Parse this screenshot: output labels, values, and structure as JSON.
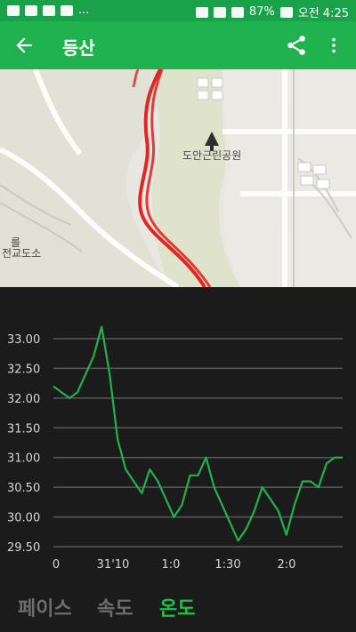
{
  "status": {
    "battery": "87%",
    "time": "오전 4:25",
    "dots": "..."
  },
  "appbar": {
    "title": "등산"
  },
  "map": {
    "label_park": "도안근린공원",
    "label_left": "전교도소",
    "label_left_top": "를"
  },
  "chart_data": {
    "type": "line",
    "title": "",
    "xlabel": "",
    "ylabel": "",
    "x_ticks": [
      "0",
      "31'10",
      "1:0",
      "1:30",
      "2:0"
    ],
    "y_ticks": [
      "33.00",
      "32.50",
      "32.00",
      "31.50",
      "31.00",
      "30.50",
      "30.00",
      "29.50"
    ],
    "ylim": [
      29.5,
      33.0
    ],
    "series": [
      {
        "color": "#20b24f",
        "x": [
          0,
          5,
          10,
          15,
          20,
          25,
          30,
          35,
          40,
          45,
          50,
          55,
          60,
          65,
          70,
          75,
          80,
          85,
          90,
          95,
          100,
          105,
          110,
          115,
          120,
          125,
          130,
          135,
          140,
          145,
          150,
          155,
          160,
          165,
          170,
          175,
          180
        ],
        "values": [
          32.2,
          32.1,
          32.0,
          32.1,
          32.4,
          32.7,
          33.2,
          32.4,
          31.3,
          30.8,
          30.6,
          30.4,
          30.8,
          30.6,
          30.3,
          30.0,
          30.2,
          30.7,
          30.7,
          31.0,
          30.5,
          30.2,
          29.9,
          29.6,
          29.8,
          30.1,
          30.5,
          30.3,
          30.1,
          29.7,
          30.2,
          30.6,
          30.6,
          30.5,
          30.9,
          31.0,
          31.0
        ]
      }
    ],
    "grid": true
  },
  "tabs": [
    "페이스",
    "속도",
    "온도"
  ],
  "active_tab": "온도"
}
